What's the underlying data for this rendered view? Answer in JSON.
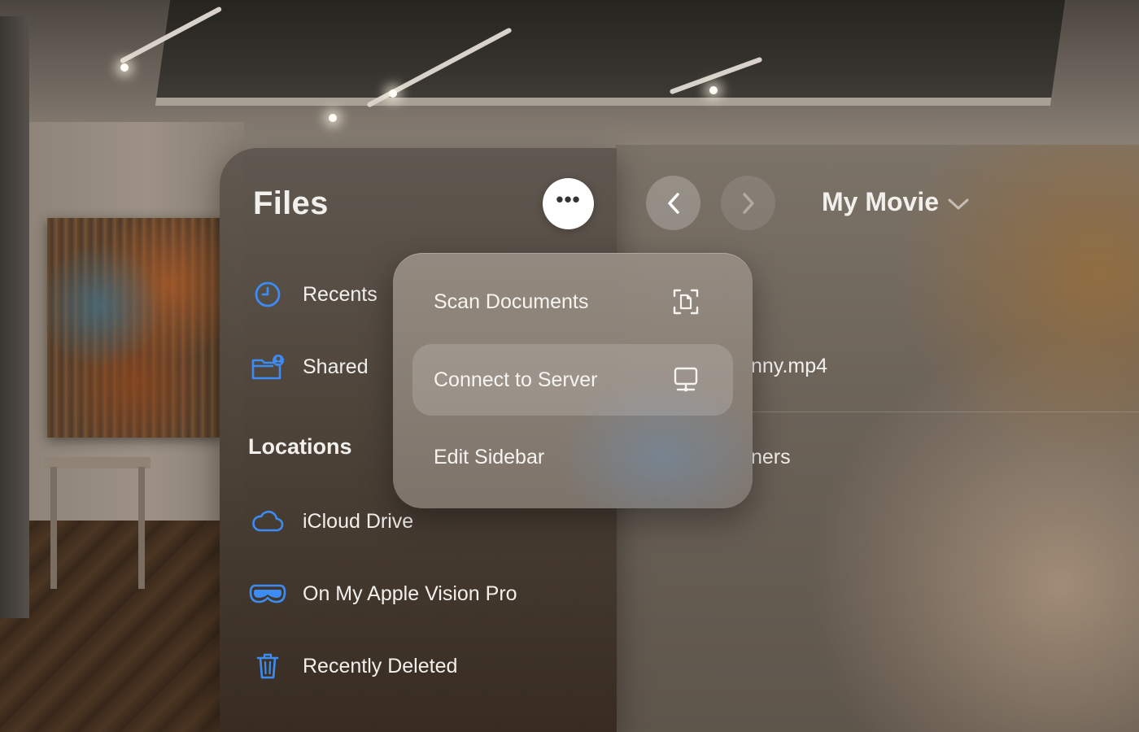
{
  "app": {
    "title": "Files"
  },
  "sidebar": {
    "more_button_label": "•••",
    "items": [
      {
        "label": "Recents",
        "icon": "clock-icon"
      },
      {
        "label": "Shared",
        "icon": "shared-folder-icon"
      }
    ],
    "locations_heading": "Locations",
    "locations": [
      {
        "label": "iCloud Drive",
        "icon": "cloud-icon"
      },
      {
        "label": "On My Apple Vision Pro",
        "icon": "vision-pro-icon"
      },
      {
        "label": "Recently Deleted",
        "icon": "trash-icon"
      }
    ]
  },
  "content": {
    "folder_title": "My Movie",
    "files": [
      {
        "name": "nny.mp4"
      },
      {
        "name": "ners"
      }
    ]
  },
  "menu": {
    "items": [
      {
        "label": "Scan Documents",
        "icon": "scan-document-icon",
        "highlighted": false
      },
      {
        "label": "Connect to Server",
        "icon": "server-monitor-icon",
        "highlighted": true
      },
      {
        "label": "Edit Sidebar",
        "icon": "",
        "highlighted": false
      }
    ]
  },
  "colors": {
    "accent": "#3b8cf5",
    "text": "#f2f0ec"
  }
}
